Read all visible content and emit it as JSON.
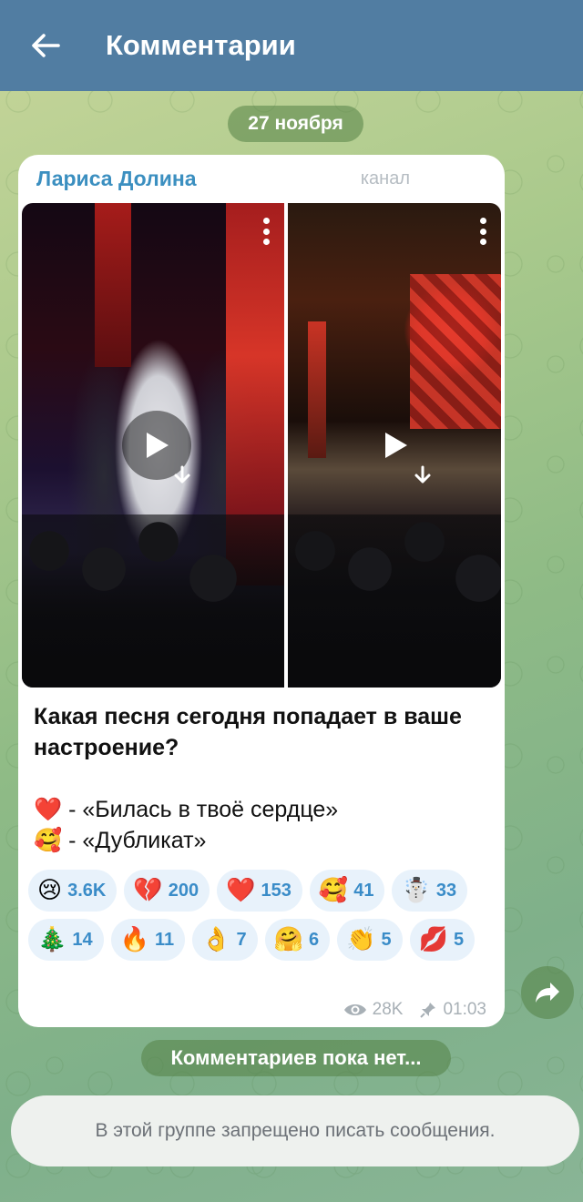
{
  "header": {
    "title": "Комментарии"
  },
  "date_separator": "27 ноября",
  "post": {
    "channel_name": "Лариса Долина",
    "channel_tag": "канал",
    "text": {
      "lead": "Какая песня сегодня попадает в ваше настроение?",
      "option1": "❤️ - «Билась в твоё сердце»",
      "option2": "🥰 - «Дубликат»"
    },
    "reactions": [
      {
        "emoji": "😢",
        "count": "3.6K"
      },
      {
        "emoji": "💔",
        "count": "200"
      },
      {
        "emoji": "❤️",
        "count": "153"
      },
      {
        "emoji": "🥰",
        "count": "41"
      },
      {
        "emoji": "☃️",
        "count": "33"
      },
      {
        "emoji": "🎄",
        "count": "14"
      },
      {
        "emoji": "🔥",
        "count": "11"
      },
      {
        "emoji": "👌",
        "count": "7"
      },
      {
        "emoji": "🤗",
        "count": "6"
      },
      {
        "emoji": "👏",
        "count": "5"
      },
      {
        "emoji": "💋",
        "count": "5"
      }
    ],
    "views": "28K",
    "time": "01:03",
    "icons": [
      "eye-icon",
      "pin-icon",
      "play-icon",
      "download-icon",
      "more-vertical-icon"
    ]
  },
  "no_comments": "Комментариев пока нет...",
  "input_notice": "В этой группе запрещено писать сообщения.",
  "colors": {
    "header_bg": "#517da2",
    "channel_name": "#3b8fc0",
    "reaction_bg": "#e8f2fb",
    "reaction_count": "#3a8cc8"
  }
}
